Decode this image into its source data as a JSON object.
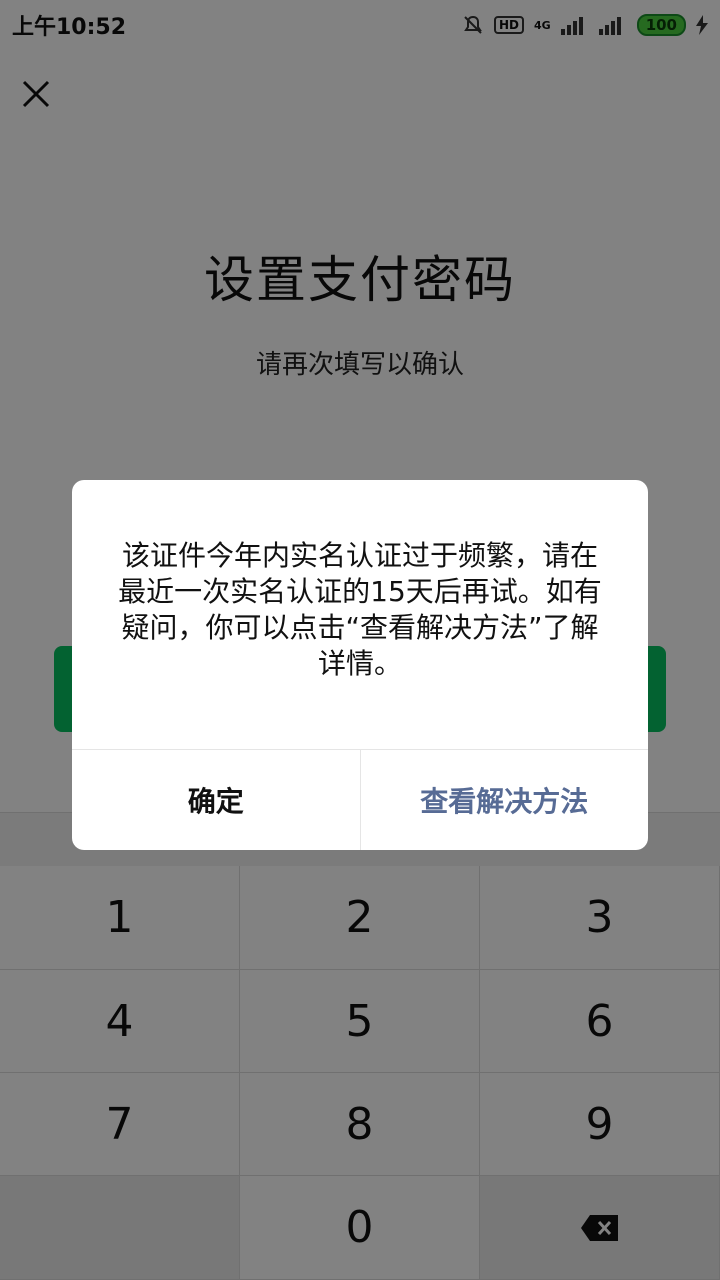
{
  "status_bar": {
    "time": "上午10:52",
    "hd": "HD",
    "network": "4G",
    "battery": "100"
  },
  "page": {
    "title": "设置支付密码",
    "subtitle": "请再次填写以确认"
  },
  "keypad": {
    "keys": [
      "1",
      "2",
      "3",
      "4",
      "5",
      "6",
      "7",
      "8",
      "9",
      "",
      "0",
      ""
    ]
  },
  "dialog": {
    "message": "该证件今年内实名认证过于频繁，请在最近一次实名认证的15天后再试。如有疑问，你可以点击“查看解决方法”了解详情。",
    "confirm_label": "确定",
    "secondary_label": "查看解决方法"
  },
  "icons": [
    "silent-bell-icon",
    "hd-icon",
    "signal-icon",
    "battery-icon",
    "charging-icon",
    "close-icon",
    "backspace-icon"
  ]
}
